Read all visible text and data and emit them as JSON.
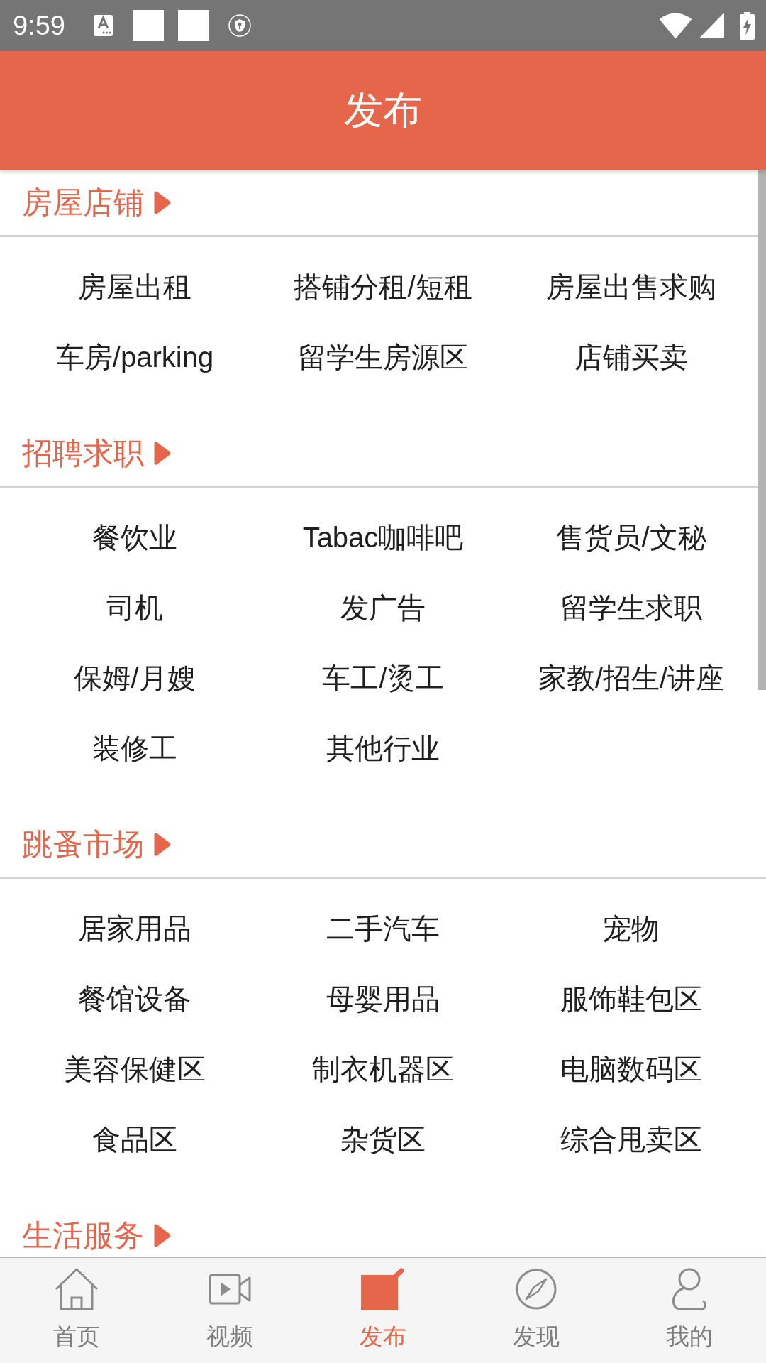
{
  "status_bar": {
    "time": "9:59"
  },
  "header": {
    "title": "发布"
  },
  "sections": [
    {
      "title": "房屋店铺",
      "items": [
        "房屋出租",
        "搭铺分租/短租",
        "房屋出售求购",
        "车房/parking",
        "留学生房源区",
        "店铺买卖"
      ]
    },
    {
      "title": "招聘求职",
      "items": [
        "餐饮业",
        "Tabac咖啡吧",
        "售货员/文秘",
        "司机",
        "发广告",
        "留学生求职",
        "保姆/月嫂",
        "车工/烫工",
        "家教/招生/讲座",
        "装修工",
        "其他行业"
      ]
    },
    {
      "title": "跳蚤市场",
      "items": [
        "居家用品",
        "二手汽车",
        "宠物",
        "餐馆设备",
        "母婴用品",
        "服饰鞋包区",
        "美容保健区",
        "制衣机器区",
        "电脑数码区",
        "食品区",
        "杂货区",
        "综合甩卖区"
      ]
    },
    {
      "title": "生活服务"
    }
  ],
  "bottom_nav": [
    {
      "label": "首页",
      "selected": false
    },
    {
      "label": "视频",
      "selected": false
    },
    {
      "label": "发布",
      "selected": true
    },
    {
      "label": "发现",
      "selected": false
    },
    {
      "label": "我的",
      "selected": false
    }
  ]
}
